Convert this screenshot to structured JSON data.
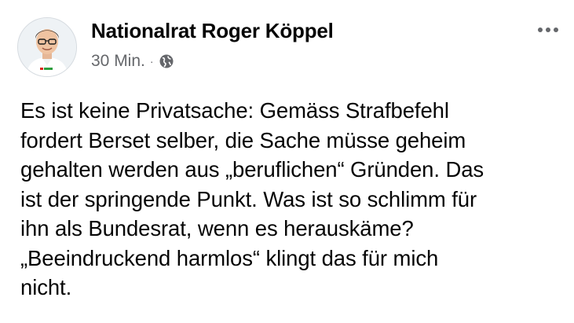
{
  "post": {
    "author": "Nationalrat Roger Köppel",
    "timestamp": "30 Min.",
    "separator": "·",
    "audience_icon": "globe-icon",
    "more_icon": "more-options-icon",
    "text": "Es ist keine Privatsache: Gemäss Strafbefehl\nfordert Berset selber, die Sache müsse geheim\ngehalten werden aus „beruflichen“ Gründen. Das\nist der springende Punkt. Was ist so schlimm für\nihn als Bundesrat, wenn es herauskäme?\n„Beeindruckend harmlos“ klingt das für mich\nnicht."
  },
  "colors": {
    "text": "#050505",
    "secondary": "#65676b",
    "background": "#ffffff"
  }
}
